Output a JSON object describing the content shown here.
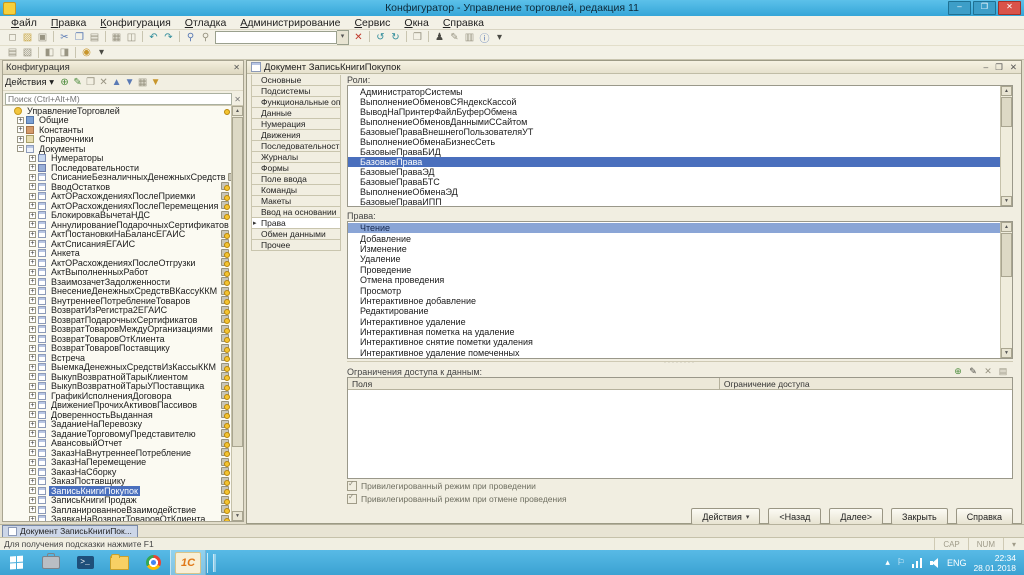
{
  "glyphs": {
    "up": "▲",
    "dn": "▼",
    "caret": "▾",
    "close": "✕",
    "check": "✓",
    "marker": "▸",
    "grip": "········",
    "min": "–",
    "max": "❐"
  },
  "window": {
    "title": "Конфигуратор - Управление торговлей, редакция 11",
    "buttons": [
      {
        "name": "minimize-button",
        "glyph": "–"
      },
      {
        "name": "maximize-button",
        "glyph": "❐"
      },
      {
        "name": "close-button",
        "glyph": "✕",
        "cls": "close"
      }
    ]
  },
  "menu": {
    "items": [
      "Файл",
      "Правка",
      "Конфигурация",
      "Отладка",
      "Администрирование",
      "Сервис",
      "Окна",
      "Справка"
    ]
  },
  "toolbar_main": {
    "icons_left": [
      {
        "name": "new-document-icon",
        "glyph": "◻",
        "cls": "c-gray"
      },
      {
        "name": "open-icon",
        "glyph": "▨",
        "cls": "c-yellow"
      },
      {
        "name": "save-icon",
        "glyph": "▣",
        "cls": "c-gray"
      },
      {
        "cls": "sep"
      },
      {
        "name": "cut-icon",
        "glyph": "✂",
        "cls": "c-blue"
      },
      {
        "name": "copy-icon",
        "glyph": "❐",
        "cls": "c-blue"
      },
      {
        "name": "paste-icon",
        "glyph": "▤",
        "cls": "c-gray"
      },
      {
        "cls": "sep"
      },
      {
        "name": "print-icon",
        "glyph": "▦",
        "cls": "c-gray"
      },
      {
        "name": "print-preview-icon",
        "glyph": "◫",
        "cls": "c-gray"
      },
      {
        "cls": "sep"
      },
      {
        "name": "undo-icon",
        "glyph": "↶",
        "cls": "c-teal"
      },
      {
        "name": "redo-icon",
        "glyph": "↷",
        "cls": "c-teal"
      },
      {
        "cls": "sep"
      },
      {
        "name": "find-icon",
        "glyph": "⚲",
        "cls": "c-blue"
      },
      {
        "name": "find-next-icon",
        "glyph": "⚲",
        "cls": "c-gray"
      }
    ],
    "search_value": "",
    "icons_right": [
      {
        "name": "search-clear-icon",
        "glyph": "✕",
        "cls": "c-red"
      },
      {
        "cls": "sep"
      },
      {
        "name": "history-back-icon",
        "glyph": "↺",
        "cls": "c-teal"
      },
      {
        "name": "history-forward-icon",
        "glyph": "↻",
        "cls": "c-teal"
      },
      {
        "cls": "sep"
      },
      {
        "name": "compare-configuration-icon",
        "glyph": "❒",
        "cls": "c-gray"
      },
      {
        "cls": "sep"
      },
      {
        "name": "update-db-configuration-icon",
        "glyph": "♟",
        "cls": "c-dark"
      },
      {
        "name": "edit-configuration-icon",
        "glyph": "✎",
        "cls": "c-gray"
      },
      {
        "name": "configuration-support-icon",
        "glyph": "▥",
        "cls": "c-gray"
      },
      {
        "name": "help-icon",
        "glyph": "ⓘ",
        "cls": "c-blue"
      },
      {
        "name": "toolbar-overflow-icon",
        "glyph": "▾",
        "cls": "c-dark"
      }
    ]
  },
  "toolbar_secondary": {
    "icons": [
      {
        "name": "messages-window-icon",
        "glyph": "▤",
        "cls": "c-gray"
      },
      {
        "name": "properties-window-icon",
        "glyph": "▧",
        "cls": "c-gray"
      },
      {
        "cls": "sep"
      },
      {
        "name": "window-split-left-icon",
        "glyph": "◧",
        "cls": "c-gray"
      },
      {
        "name": "window-split-right-icon",
        "glyph": "◨",
        "cls": "c-gray"
      },
      {
        "cls": "sep"
      },
      {
        "name": "help-contents-icon",
        "glyph": "◉",
        "cls": "c-amber"
      },
      {
        "name": "toolbar2-overflow-icon",
        "glyph": "▾",
        "cls": "c-dark"
      }
    ]
  },
  "config_panel": {
    "title": "Конфигурация",
    "actions_label": "Действия",
    "actions_caret": "▾",
    "toolbar_icons": [
      {
        "name": "add-icon",
        "glyph": "⊕",
        "cls": "c-green"
      },
      {
        "name": "edit-icon",
        "glyph": "✎",
        "cls": "c-green"
      },
      {
        "name": "copy-icon",
        "glyph": "❐",
        "cls": "c-gray"
      },
      {
        "name": "delete-icon",
        "glyph": "✕",
        "cls": "c-gray"
      },
      {
        "name": "move-up-icon",
        "glyph": "▲",
        "cls": "c-blue"
      },
      {
        "name": "move-down-icon",
        "glyph": "▼",
        "cls": "c-blue"
      },
      {
        "name": "sort-icon",
        "glyph": "▦",
        "cls": "c-gray"
      },
      {
        "name": "filter-icon",
        "glyph": "▼",
        "cls": "c-amber"
      }
    ],
    "search_placeholder": "Поиск (Ctrl+Alt+M)",
    "tree": [
      {
        "label": "УправлениеТорговлей",
        "level": 0,
        "exp": "",
        "cls": "ic-root dotonly"
      },
      {
        "label": "Общие",
        "level": 1,
        "exp": "+",
        "cls": "ic-common nolock"
      },
      {
        "label": "Константы",
        "level": 1,
        "exp": "+",
        "cls": "ic-const nolock"
      },
      {
        "label": "Справочники",
        "level": 1,
        "exp": "+",
        "cls": "ic-catalog nolock"
      },
      {
        "label": "Документы",
        "level": 1,
        "exp": "−",
        "cls": "ic-docs nolock"
      },
      {
        "label": "Нумераторы",
        "level": 2,
        "exp": "+",
        "cls": "ic-num nolock"
      },
      {
        "label": "Последовательности",
        "level": 2,
        "exp": "+",
        "cls": "ic-seq nolock"
      },
      {
        "label": "СписаниеБезналичныхДенежныхСредств",
        "level": 2,
        "exp": "+",
        "cls": "ic-doc"
      },
      {
        "label": "ВводОстатков",
        "level": 2,
        "exp": "+",
        "cls": "ic-doc"
      },
      {
        "label": "АктОРасхожденияхПослеПриемки",
        "level": 2,
        "exp": "+",
        "cls": "ic-doc"
      },
      {
        "label": "АктОРасхожденияхПослеПеремещения",
        "level": 2,
        "exp": "+",
        "cls": "ic-doc"
      },
      {
        "label": "БлокировкаВычетаНДС",
        "level": 2,
        "exp": "+",
        "cls": "ic-doc"
      },
      {
        "label": "АннулированиеПодарочныхСертификатов",
        "level": 2,
        "exp": "+",
        "cls": "ic-doc"
      },
      {
        "label": "АктПостановкиНаБалансЕГАИС",
        "level": 2,
        "exp": "+",
        "cls": "ic-doc"
      },
      {
        "label": "АктСписанияЕГАИС",
        "level": 2,
        "exp": "+",
        "cls": "ic-doc"
      },
      {
        "label": "Анкета",
        "level": 2,
        "exp": "+",
        "cls": "ic-doc"
      },
      {
        "label": "АктОРасхожденияхПослеОтгрузки",
        "level": 2,
        "exp": "+",
        "cls": "ic-doc"
      },
      {
        "label": "АктВыполненныхРабот",
        "level": 2,
        "exp": "+",
        "cls": "ic-doc"
      },
      {
        "label": "ВзаимозачетЗадолженности",
        "level": 2,
        "exp": "+",
        "cls": "ic-doc"
      },
      {
        "label": "ВнесениеДенежныхСредствВКассуККМ",
        "level": 2,
        "exp": "+",
        "cls": "ic-doc"
      },
      {
        "label": "ВнутреннееПотреблениеТоваров",
        "level": 2,
        "exp": "+",
        "cls": "ic-doc"
      },
      {
        "label": "ВозвратИзРегистра2ЕГАИС",
        "level": 2,
        "exp": "+",
        "cls": "ic-doc"
      },
      {
        "label": "ВозвратПодарочныхСертификатов",
        "level": 2,
        "exp": "+",
        "cls": "ic-doc"
      },
      {
        "label": "ВозвратТоваровМеждуОрганизациями",
        "level": 2,
        "exp": "+",
        "cls": "ic-doc"
      },
      {
        "label": "ВозвратТоваровОтКлиента",
        "level": 2,
        "exp": "+",
        "cls": "ic-doc"
      },
      {
        "label": "ВозвратТоваровПоставщику",
        "level": 2,
        "exp": "+",
        "cls": "ic-doc"
      },
      {
        "label": "Встреча",
        "level": 2,
        "exp": "+",
        "cls": "ic-doc"
      },
      {
        "label": "ВыемкаДенежныхСредствИзКассыККМ",
        "level": 2,
        "exp": "+",
        "cls": "ic-doc"
      },
      {
        "label": "ВыкупВозвратнойТарыКлиентом",
        "level": 2,
        "exp": "+",
        "cls": "ic-doc"
      },
      {
        "label": "ВыкупВозвратнойТарыУПоставщика",
        "level": 2,
        "exp": "+",
        "cls": "ic-doc"
      },
      {
        "label": "ГрафикИсполненияДоговора",
        "level": 2,
        "exp": "+",
        "cls": "ic-doc"
      },
      {
        "label": "ДвижениеПрочихАктивовПассивов",
        "level": 2,
        "exp": "+",
        "cls": "ic-doc"
      },
      {
        "label": "ДоверенностьВыданная",
        "level": 2,
        "exp": "+",
        "cls": "ic-doc"
      },
      {
        "label": "ЗаданиеНаПеревозку",
        "level": 2,
        "exp": "+",
        "cls": "ic-doc"
      },
      {
        "label": "ЗаданиеТорговомуПредставителю",
        "level": 2,
        "exp": "+",
        "cls": "ic-doc"
      },
      {
        "label": "АвансовыйОтчет",
        "level": 2,
        "exp": "+",
        "cls": "ic-doc"
      },
      {
        "label": "ЗаказНаВнутреннееПотребление",
        "level": 2,
        "exp": "+",
        "cls": "ic-doc"
      },
      {
        "label": "ЗаказНаПеремещение",
        "level": 2,
        "exp": "+",
        "cls": "ic-doc"
      },
      {
        "label": "ЗаказНаСборку",
        "level": 2,
        "exp": "+",
        "cls": "ic-doc"
      },
      {
        "label": "ЗаказПоставщику",
        "level": 2,
        "exp": "+",
        "cls": "ic-doc"
      },
      {
        "label": "ЗаписьКнигиПокупок",
        "level": 2,
        "exp": "+",
        "cls": "ic-doc",
        "selected": true
      },
      {
        "label": "ЗаписьКнигиПродаж",
        "level": 2,
        "exp": "+",
        "cls": "ic-doc"
      },
      {
        "label": "ЗапланированноеВзаимодействие",
        "level": 2,
        "exp": "+",
        "cls": "ic-doc"
      },
      {
        "label": "ЗаявкаНаВозвратТоваровОтКлиента",
        "level": 2,
        "exp": "+",
        "cls": "ic-doc"
      }
    ]
  },
  "doc_window": {
    "title": "Документ ЗаписьКнигиПокупок",
    "controls": [
      {
        "name": "doc-minimize-button",
        "glyph": "–"
      },
      {
        "name": "doc-restore-button",
        "glyph": "❐"
      },
      {
        "name": "doc-close-button",
        "glyph": "✕"
      }
    ],
    "tab_marker": "▸",
    "tabs": [
      {
        "label": "Основные"
      },
      {
        "label": "Подсистемы"
      },
      {
        "label": "Функциональные опции"
      },
      {
        "label": "Данные"
      },
      {
        "label": "Нумерация"
      },
      {
        "label": "Движения"
      },
      {
        "label": "Последовательности"
      },
      {
        "label": "Журналы"
      },
      {
        "label": "Формы"
      },
      {
        "label": "Поле ввода"
      },
      {
        "label": "Команды"
      },
      {
        "label": "Макеты"
      },
      {
        "label": "Ввод на основании"
      },
      {
        "label": "Права",
        "selected": true
      },
      {
        "label": "Обмен данными"
      },
      {
        "label": "Прочее"
      }
    ],
    "roles_label": "Роли:",
    "roles": [
      {
        "label": "АдминистраторСистемы"
      },
      {
        "label": "ВыполнениеОбменовСЯндексКассой"
      },
      {
        "label": "ВыводНаПринтерФайлБуферОбмена"
      },
      {
        "label": "ВыполнениеОбменовДаннымиССайтом"
      },
      {
        "label": "БазовыеПраваВнешнегоПользователяУТ"
      },
      {
        "label": "ВыполнениеОбменаБизнесСеть"
      },
      {
        "label": "БазовыеПраваБИД"
      },
      {
        "label": "БазовыеПрава",
        "selected": true
      },
      {
        "label": "БазовыеПраваЭД"
      },
      {
        "label": "БазовыеПраваБТС"
      },
      {
        "label": "ВыполнениеОбменаЭД"
      },
      {
        "label": "БазовыеПраваИПП"
      }
    ],
    "rights_label": "Права:",
    "rights": [
      {
        "label": "Чтение",
        "selected": true
      },
      {
        "label": "Добавление"
      },
      {
        "label": "Изменение"
      },
      {
        "label": "Удаление"
      },
      {
        "label": "Проведение"
      },
      {
        "label": "Отмена проведения"
      },
      {
        "label": "Просмотр"
      },
      {
        "label": "Интерактивное добавление"
      },
      {
        "label": "Редактирование"
      },
      {
        "label": "Интерактивное удаление"
      },
      {
        "label": "Интерактивная пометка на удаление"
      },
      {
        "label": "Интерактивное снятие пометки удаления"
      },
      {
        "label": "Интерактивное удаление помеченных"
      }
    ],
    "restrictions": {
      "label": "Ограничения доступа к данным:",
      "icons": [
        {
          "name": "restriction-add-icon",
          "glyph": "⊕",
          "cls": "c-green"
        },
        {
          "name": "restriction-edit-icon",
          "glyph": "✎",
          "cls": "c-dark"
        },
        {
          "name": "restriction-delete-icon",
          "glyph": "✕",
          "cls": "c-gray"
        },
        {
          "name": "restriction-templates-icon",
          "glyph": "▤",
          "cls": "c-gray"
        }
      ],
      "columns": [
        "Поля",
        "Ограничение доступа"
      ]
    },
    "checkboxes": [
      {
        "label": "Привилегированный режим при проведении",
        "checked": true
      },
      {
        "label": "Привилегированный режим при отмене проведения",
        "checked": true
      }
    ],
    "buttons": [
      {
        "label": "Действия",
        "arrow": "▾"
      },
      {
        "label": "<Назад"
      },
      {
        "label": "Далее>"
      },
      {
        "label": "Закрыть"
      },
      {
        "label": "Справка"
      }
    ]
  },
  "bottom_tab": {
    "label": "Документ ЗаписьКнигиПок..."
  },
  "status_bar": {
    "hint": "Для получения подсказки нажмите F1",
    "indicators": [
      {
        "label": "CAP"
      },
      {
        "label": "NUM"
      },
      {
        "label": "▾"
      }
    ]
  },
  "taskbar": {
    "app_label": "1С",
    "tray": {
      "icons": [
        {
          "name": "tray-expand-icon",
          "glyph": "▴"
        },
        {
          "name": "notification-flag-icon",
          "glyph": "⚐"
        }
      ],
      "lang": "ENG",
      "time": "22:34",
      "date": "28.01.2018"
    }
  }
}
